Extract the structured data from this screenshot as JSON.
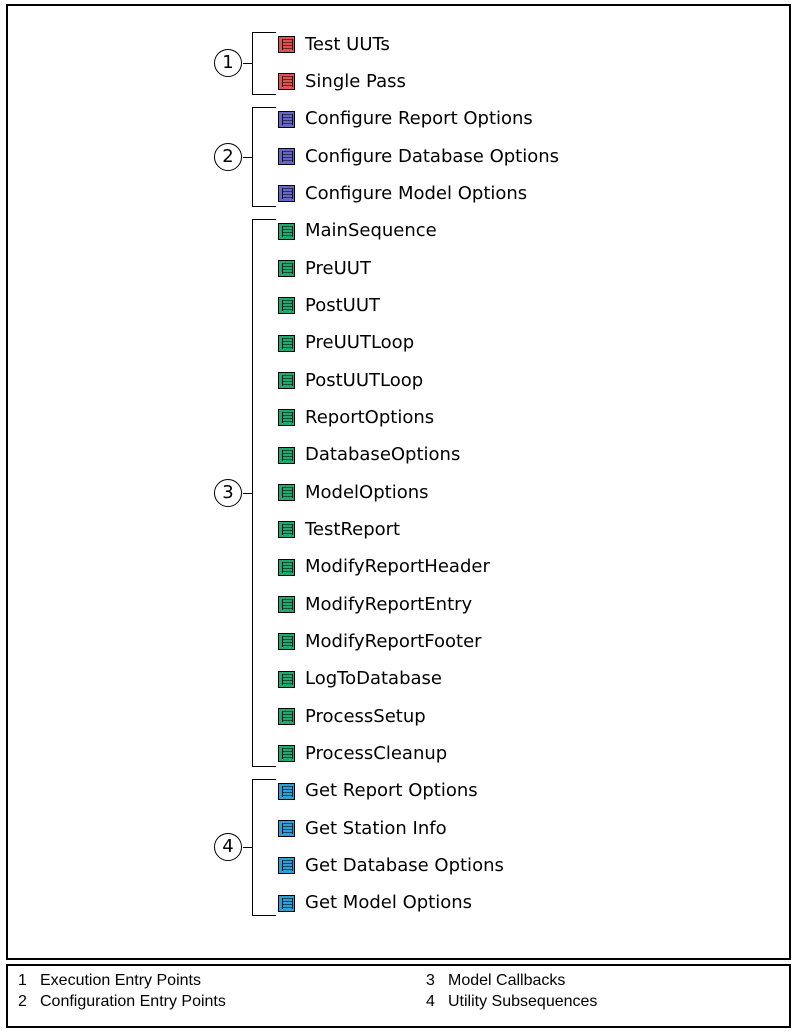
{
  "groups": [
    {
      "number": "1",
      "color": "#e05252",
      "items": [
        "Test UUTs",
        "Single Pass"
      ]
    },
    {
      "number": "2",
      "color": "#6666c4",
      "items": [
        "Configure Report Options",
        "Configure Database Options",
        "Configure Model Options"
      ]
    },
    {
      "number": "3",
      "color": "#1fa872",
      "items": [
        "MainSequence",
        "PreUUT",
        "PostUUT",
        "PreUUTLoop",
        "PostUUTLoop",
        "ReportOptions",
        "DatabaseOptions",
        "ModelOptions",
        "TestReport",
        "ModifyReportHeader",
        "ModifyReportEntry",
        "ModifyReportFooter",
        "LogToDatabase",
        "ProcessSetup",
        "ProcessCleanup"
      ]
    },
    {
      "number": "4",
      "color": "#2b9fd6",
      "items": [
        "Get Report Options",
        "Get Station Info",
        "Get Database Options",
        "Get Model Options"
      ]
    }
  ],
  "legend": [
    {
      "number": "1",
      "label": "Execution Entry Points"
    },
    {
      "number": "2",
      "label": "Configuration Entry Points"
    },
    {
      "number": "3",
      "label": "Model Callbacks"
    },
    {
      "number": "4",
      "label": "Utility Subsequences"
    }
  ]
}
